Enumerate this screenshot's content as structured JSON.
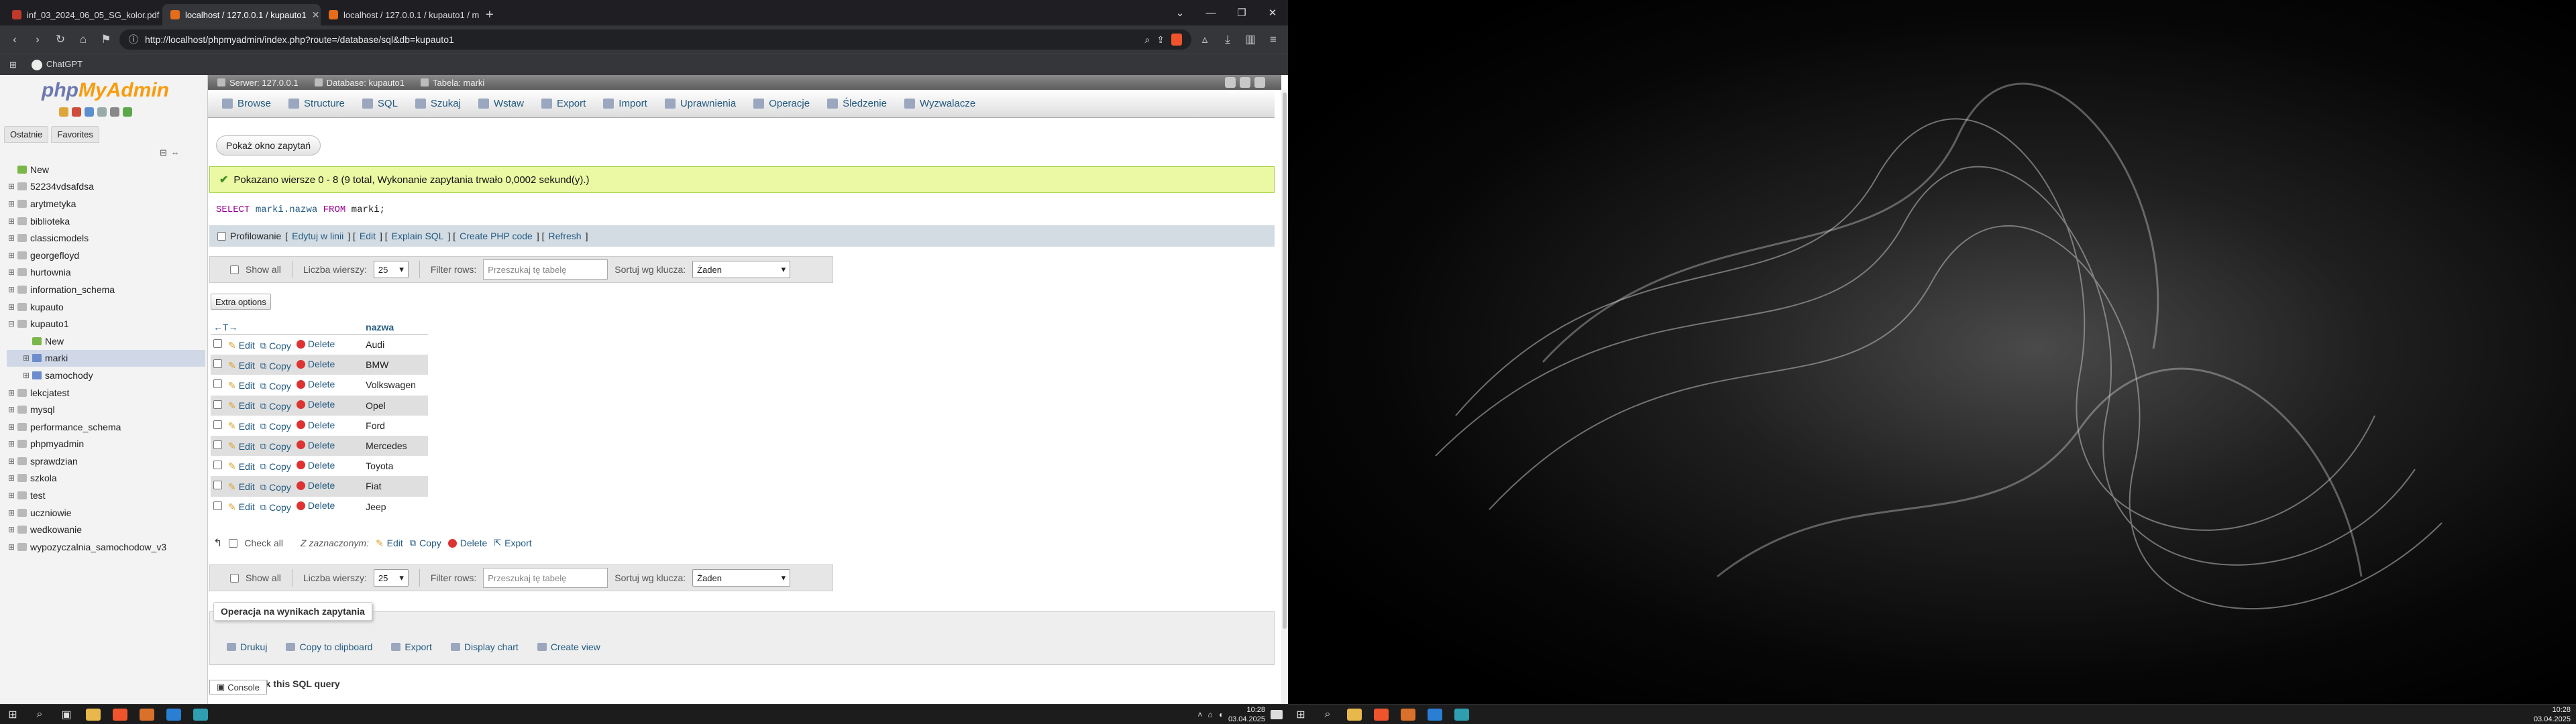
{
  "browser": {
    "tabs": [
      {
        "title": "inf_03_2024_06_05_SG_kolor.pdf"
      },
      {
        "title": "localhost / 127.0.0.1 / kupauto1"
      },
      {
        "title": "localhost / 127.0.0.1 / kupauto1 / m"
      }
    ],
    "url": "http://localhost/phpmyadmin/index.php?route=/database/sql&db=kupauto1",
    "bookmarks": [
      {
        "label": "ChatGPT"
      }
    ]
  },
  "pma": {
    "logo": {
      "php": "php",
      "myadmin": "MyAdmin"
    },
    "nav_tabs": [
      "Ostatnie",
      "Favorites"
    ],
    "tree": [
      {
        "label": "New",
        "type": "new",
        "level": 0
      },
      {
        "label": "52234vdsafdsa",
        "type": "db",
        "level": 0
      },
      {
        "label": "arytmetyka",
        "type": "db",
        "level": 0
      },
      {
        "label": "biblioteka",
        "type": "db",
        "level": 0
      },
      {
        "label": "classicmodels",
        "type": "db",
        "level": 0
      },
      {
        "label": "georgefloyd",
        "type": "db",
        "level": 0
      },
      {
        "label": "hurtownia",
        "type": "db",
        "level": 0
      },
      {
        "label": "information_schema",
        "type": "db",
        "level": 0
      },
      {
        "label": "kupauto",
        "type": "db",
        "level": 0
      },
      {
        "label": "kupauto1",
        "type": "db",
        "level": 0,
        "expanded": true
      },
      {
        "label": "New",
        "type": "new",
        "level": 1
      },
      {
        "label": "marki",
        "type": "table",
        "level": 1,
        "selected": true
      },
      {
        "label": "samochody",
        "type": "table",
        "level": 1
      },
      {
        "label": "lekcjatest",
        "type": "db",
        "level": 0
      },
      {
        "label": "mysql",
        "type": "db",
        "level": 0
      },
      {
        "label": "performance_schema",
        "type": "db",
        "level": 0
      },
      {
        "label": "phpmyadmin",
        "type": "db",
        "level": 0
      },
      {
        "label": "sprawdzian",
        "type": "db",
        "level": 0
      },
      {
        "label": "szkola",
        "type": "db",
        "level": 0
      },
      {
        "label": "test",
        "type": "db",
        "level": 0
      },
      {
        "label": "uczniowie",
        "type": "db",
        "level": 0
      },
      {
        "label": "wedkowanie",
        "type": "db",
        "level": 0
      },
      {
        "label": "wypozyczalnia_samochodow_v3",
        "type": "db",
        "level": 0
      }
    ],
    "breadcrumb": {
      "server": "Serwer: 127.0.0.1",
      "database": "Database: kupauto1",
      "table": "Tabela: marki"
    },
    "menu": [
      "Browse",
      "Structure",
      "SQL",
      "Szukaj",
      "Wstaw",
      "Export",
      "Import",
      "Uprawnienia",
      "Operacje",
      "Śledzenie",
      "Wyzwalacze"
    ],
    "show_query_button": "Pokaż okno zapytań",
    "success_message": "Pokazano wiersze 0 - 8 (9 total, Wykonanie zapytania trwało 0,0002 sekund(y).)",
    "sql": {
      "select": "SELECT",
      "columns": "marki.nazwa",
      "from": "FROM",
      "table": "marki;"
    },
    "profiling": {
      "label": "Profilowanie",
      "links": [
        "Edytuj w linii",
        "Edit",
        "Explain SQL",
        "Create PHP code",
        "Refresh"
      ]
    },
    "nav_controls": {
      "show_all": "Show all",
      "rows_label": "Liczba wierszy:",
      "rows_value": "25",
      "filter_label": "Filter rows:",
      "filter_placeholder": "Przeszukaj tę tabelę",
      "sort_label": "Sortuj wg klucza:",
      "sort_value": "Żaden"
    },
    "extra_options": "Extra options",
    "table": {
      "column_header": "nazwa",
      "actions": {
        "edit": "Edit",
        "copy": "Copy",
        "delete": "Delete"
      },
      "rows": [
        "Audi",
        "BMW",
        "Volkswagen",
        "Opel",
        "Ford",
        "Mercedes",
        "Toyota",
        "Fiat",
        "Jeep"
      ]
    },
    "bulk": {
      "check_all": "Check all",
      "with_selected": "Z zaznaczonym:",
      "edit": "Edit",
      "copy": "Copy",
      "delete": "Delete",
      "export": "Export"
    },
    "query_ops": {
      "legend": "Operacja na wynikach zapytania",
      "links": [
        "Drukuj",
        "Copy to clipboard",
        "Export",
        "Display chart",
        "Create view"
      ]
    },
    "bookmark_label": "mark this SQL query",
    "console": "Console"
  },
  "taskbar": {
    "time": "10:28",
    "date": "03.04.2025"
  }
}
